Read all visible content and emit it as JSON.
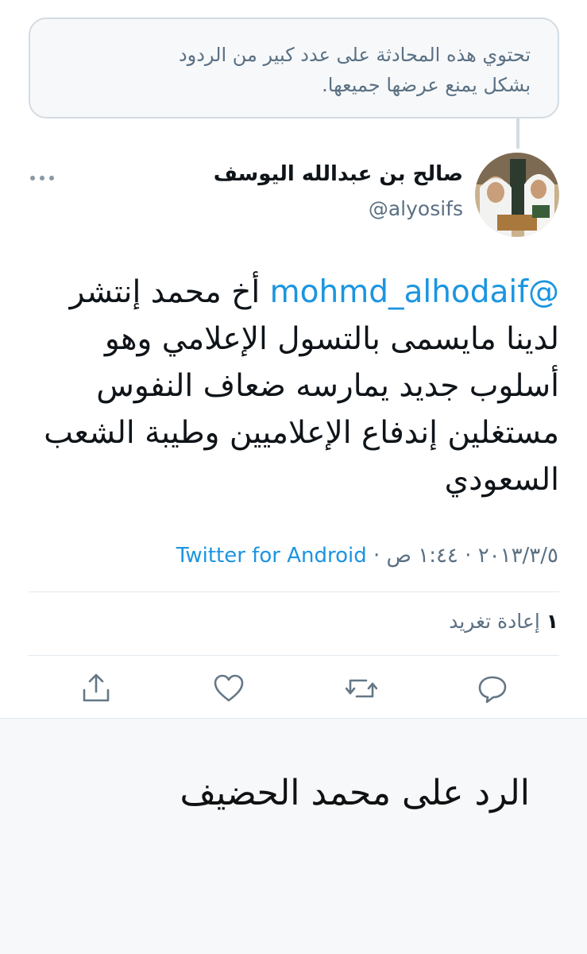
{
  "notice": {
    "line1": "تحتوي هذه المحادثة على عدد كبير من الردود",
    "line2": "بشكل يمنع عرضها جميعها."
  },
  "tweet": {
    "display_name": "صالح بن عبدالله اليوسف",
    "handle": "@alyosifs",
    "mention": "@mohmd_alhodaif",
    "text_line1_after_mention": " أخ محمد إنتشر",
    "text_line2": "لدينا مايسمى بالتسول الإعلامي وهو",
    "text_line3": "أسلوب جديد يمارسه ضعاف النفوس",
    "text_line4": "مستغلين إندفاع الإعلاميين وطيبة الشعب",
    "text_line5": "السعودي",
    "date": "٢٠١٣/٣/٥",
    "separator": " · ",
    "time": "١:٤٤ ص",
    "source": "Twitter for Android"
  },
  "stats": {
    "retweet_count": "١",
    "retweet_label": "إعادة تغريد"
  },
  "actions": {
    "icons": [
      "reply-icon",
      "retweet-icon",
      "like-icon",
      "share-icon"
    ]
  },
  "caption": {
    "text": "الرد على محمد الحضيف"
  },
  "colors": {
    "accent": "#1b95e0",
    "secondary_text": "#5b7083",
    "primary_text": "#0f1419",
    "border": "#d3dce3",
    "panel_bg": "#f6f8fa"
  }
}
